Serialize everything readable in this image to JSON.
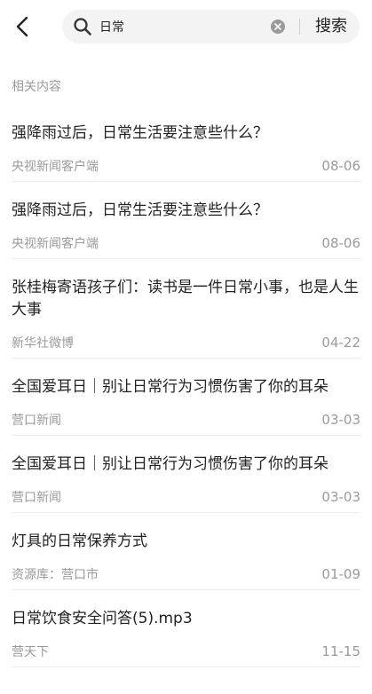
{
  "header": {
    "search_value": "日常",
    "search_button_label": "搜索"
  },
  "section_label": "相关内容",
  "results": [
    {
      "title": "强降雨过后，日常生活要注意些什么？",
      "source": "央视新闻客户端",
      "date": "08-06"
    },
    {
      "title": "强降雨过后，日常生活要注意些什么？",
      "source": "央视新闻客户端",
      "date": "08-06"
    },
    {
      "title": "张桂梅寄语孩子们：读书是一件日常小事，也是人生大事",
      "source": "新华社微博",
      "date": "04-22"
    },
    {
      "title": "全国爱耳日｜别让日常行为习惯伤害了你的耳朵",
      "source": "营口新闻",
      "date": "03-03"
    },
    {
      "title": "全国爱耳日｜别让日常行为习惯伤害了你的耳朵",
      "source": "营口新闻",
      "date": "03-03"
    },
    {
      "title": "灯具的日常保养方式",
      "source": "资源库：营口市",
      "date": "01-09"
    },
    {
      "title": "日常饮食安全问答(5).mp3",
      "source": "营天下",
      "date": "11-15"
    }
  ],
  "icons": {
    "back": "chevron-left-icon",
    "search": "search-icon",
    "clear": "clear-icon"
  }
}
